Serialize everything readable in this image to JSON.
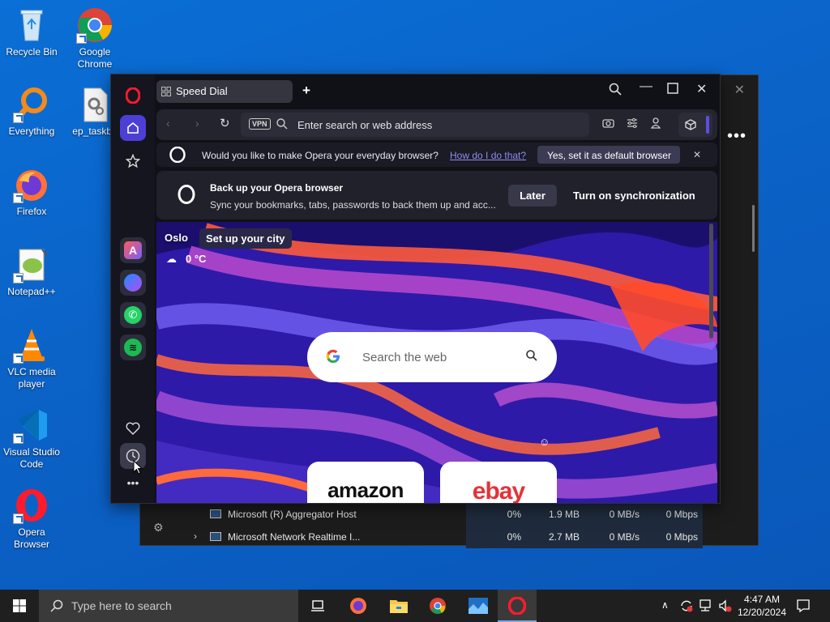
{
  "desktop": {
    "icons": [
      {
        "label": "Recycle Bin",
        "icon": "recycle-bin-icon"
      },
      {
        "label": "Google Chrome",
        "icon": "chrome-icon"
      },
      {
        "label": "Everything",
        "icon": "everything-search-icon"
      },
      {
        "label": "ep_taskba",
        "icon": "settings-file-icon"
      },
      {
        "label": "Firefox",
        "icon": "firefox-icon"
      },
      {
        "label": "Notepad++",
        "icon": "notepad-plus-plus-icon"
      },
      {
        "label": "VLC media player",
        "icon": "vlc-icon"
      },
      {
        "label": "Visual Studio Code",
        "icon": "vscode-icon"
      },
      {
        "label": "Opera Browser",
        "icon": "opera-icon"
      }
    ]
  },
  "task_manager": {
    "rows": [
      {
        "name": "Microsoft (R) Aggregator Host",
        "cpu": "0%",
        "memory": "1.9 MB",
        "disk": "0 MB/s",
        "network": "0 Mbps"
      },
      {
        "name": "Microsoft Network Realtime I...",
        "cpu": "0%",
        "memory": "2.7 MB",
        "disk": "0 MB/s",
        "network": "0 Mbps"
      }
    ]
  },
  "opera": {
    "tab_label": "Speed Dial",
    "address_placeholder": "Enter search or web address",
    "vpn_label": "VPN",
    "default_bar": {
      "question": "Would you like to make Opera your everyday browser?",
      "link": "How do I do that?",
      "button": "Yes, set it as default browser"
    },
    "sync_bar": {
      "title": "Back up your Opera browser",
      "subtitle": "Sync your bookmarks, tabs, passwords to back them up and acc...",
      "later": "Later",
      "turn_on": "Turn on synchronization"
    },
    "weather": {
      "city": "Oslo",
      "setup": "Set up your city",
      "temperature": "0 °C"
    },
    "search_placeholder": "Search the web",
    "speed_dial": [
      "amazon",
      "ebay"
    ]
  },
  "taskbar": {
    "search_placeholder": "Type here to search",
    "time": "4:47 AM",
    "date": "12/20/2024"
  },
  "colors": {
    "desktop_blue": "#0b63c8",
    "opera_red": "#ff1b2d",
    "accent_purple": "#5b4fe0"
  }
}
